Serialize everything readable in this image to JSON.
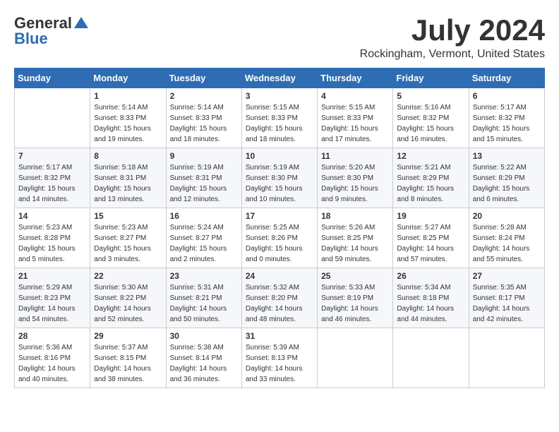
{
  "header": {
    "logo_general": "General",
    "logo_blue": "Blue",
    "month": "July 2024",
    "location": "Rockingham, Vermont, United States"
  },
  "weekdays": [
    "Sunday",
    "Monday",
    "Tuesday",
    "Wednesday",
    "Thursday",
    "Friday",
    "Saturday"
  ],
  "weeks": [
    [
      {
        "day": "",
        "info": ""
      },
      {
        "day": "1",
        "info": "Sunrise: 5:14 AM\nSunset: 8:33 PM\nDaylight: 15 hours\nand 19 minutes."
      },
      {
        "day": "2",
        "info": "Sunrise: 5:14 AM\nSunset: 8:33 PM\nDaylight: 15 hours\nand 18 minutes."
      },
      {
        "day": "3",
        "info": "Sunrise: 5:15 AM\nSunset: 8:33 PM\nDaylight: 15 hours\nand 18 minutes."
      },
      {
        "day": "4",
        "info": "Sunrise: 5:15 AM\nSunset: 8:33 PM\nDaylight: 15 hours\nand 17 minutes."
      },
      {
        "day": "5",
        "info": "Sunrise: 5:16 AM\nSunset: 8:32 PM\nDaylight: 15 hours\nand 16 minutes."
      },
      {
        "day": "6",
        "info": "Sunrise: 5:17 AM\nSunset: 8:32 PM\nDaylight: 15 hours\nand 15 minutes."
      }
    ],
    [
      {
        "day": "7",
        "info": "Sunrise: 5:17 AM\nSunset: 8:32 PM\nDaylight: 15 hours\nand 14 minutes."
      },
      {
        "day": "8",
        "info": "Sunrise: 5:18 AM\nSunset: 8:31 PM\nDaylight: 15 hours\nand 13 minutes."
      },
      {
        "day": "9",
        "info": "Sunrise: 5:19 AM\nSunset: 8:31 PM\nDaylight: 15 hours\nand 12 minutes."
      },
      {
        "day": "10",
        "info": "Sunrise: 5:19 AM\nSunset: 8:30 PM\nDaylight: 15 hours\nand 10 minutes."
      },
      {
        "day": "11",
        "info": "Sunrise: 5:20 AM\nSunset: 8:30 PM\nDaylight: 15 hours\nand 9 minutes."
      },
      {
        "day": "12",
        "info": "Sunrise: 5:21 AM\nSunset: 8:29 PM\nDaylight: 15 hours\nand 8 minutes."
      },
      {
        "day": "13",
        "info": "Sunrise: 5:22 AM\nSunset: 8:29 PM\nDaylight: 15 hours\nand 6 minutes."
      }
    ],
    [
      {
        "day": "14",
        "info": "Sunrise: 5:23 AM\nSunset: 8:28 PM\nDaylight: 15 hours\nand 5 minutes."
      },
      {
        "day": "15",
        "info": "Sunrise: 5:23 AM\nSunset: 8:27 PM\nDaylight: 15 hours\nand 3 minutes."
      },
      {
        "day": "16",
        "info": "Sunrise: 5:24 AM\nSunset: 8:27 PM\nDaylight: 15 hours\nand 2 minutes."
      },
      {
        "day": "17",
        "info": "Sunrise: 5:25 AM\nSunset: 8:26 PM\nDaylight: 15 hours\nand 0 minutes."
      },
      {
        "day": "18",
        "info": "Sunrise: 5:26 AM\nSunset: 8:25 PM\nDaylight: 14 hours\nand 59 minutes."
      },
      {
        "day": "19",
        "info": "Sunrise: 5:27 AM\nSunset: 8:25 PM\nDaylight: 14 hours\nand 57 minutes."
      },
      {
        "day": "20",
        "info": "Sunrise: 5:28 AM\nSunset: 8:24 PM\nDaylight: 14 hours\nand 55 minutes."
      }
    ],
    [
      {
        "day": "21",
        "info": "Sunrise: 5:29 AM\nSunset: 8:23 PM\nDaylight: 14 hours\nand 54 minutes."
      },
      {
        "day": "22",
        "info": "Sunrise: 5:30 AM\nSunset: 8:22 PM\nDaylight: 14 hours\nand 52 minutes."
      },
      {
        "day": "23",
        "info": "Sunrise: 5:31 AM\nSunset: 8:21 PM\nDaylight: 14 hours\nand 50 minutes."
      },
      {
        "day": "24",
        "info": "Sunrise: 5:32 AM\nSunset: 8:20 PM\nDaylight: 14 hours\nand 48 minutes."
      },
      {
        "day": "25",
        "info": "Sunrise: 5:33 AM\nSunset: 8:19 PM\nDaylight: 14 hours\nand 46 minutes."
      },
      {
        "day": "26",
        "info": "Sunrise: 5:34 AM\nSunset: 8:18 PM\nDaylight: 14 hours\nand 44 minutes."
      },
      {
        "day": "27",
        "info": "Sunrise: 5:35 AM\nSunset: 8:17 PM\nDaylight: 14 hours\nand 42 minutes."
      }
    ],
    [
      {
        "day": "28",
        "info": "Sunrise: 5:36 AM\nSunset: 8:16 PM\nDaylight: 14 hours\nand 40 minutes."
      },
      {
        "day": "29",
        "info": "Sunrise: 5:37 AM\nSunset: 8:15 PM\nDaylight: 14 hours\nand 38 minutes."
      },
      {
        "day": "30",
        "info": "Sunrise: 5:38 AM\nSunset: 8:14 PM\nDaylight: 14 hours\nand 36 minutes."
      },
      {
        "day": "31",
        "info": "Sunrise: 5:39 AM\nSunset: 8:13 PM\nDaylight: 14 hours\nand 33 minutes."
      },
      {
        "day": "",
        "info": ""
      },
      {
        "day": "",
        "info": ""
      },
      {
        "day": "",
        "info": ""
      }
    ]
  ]
}
